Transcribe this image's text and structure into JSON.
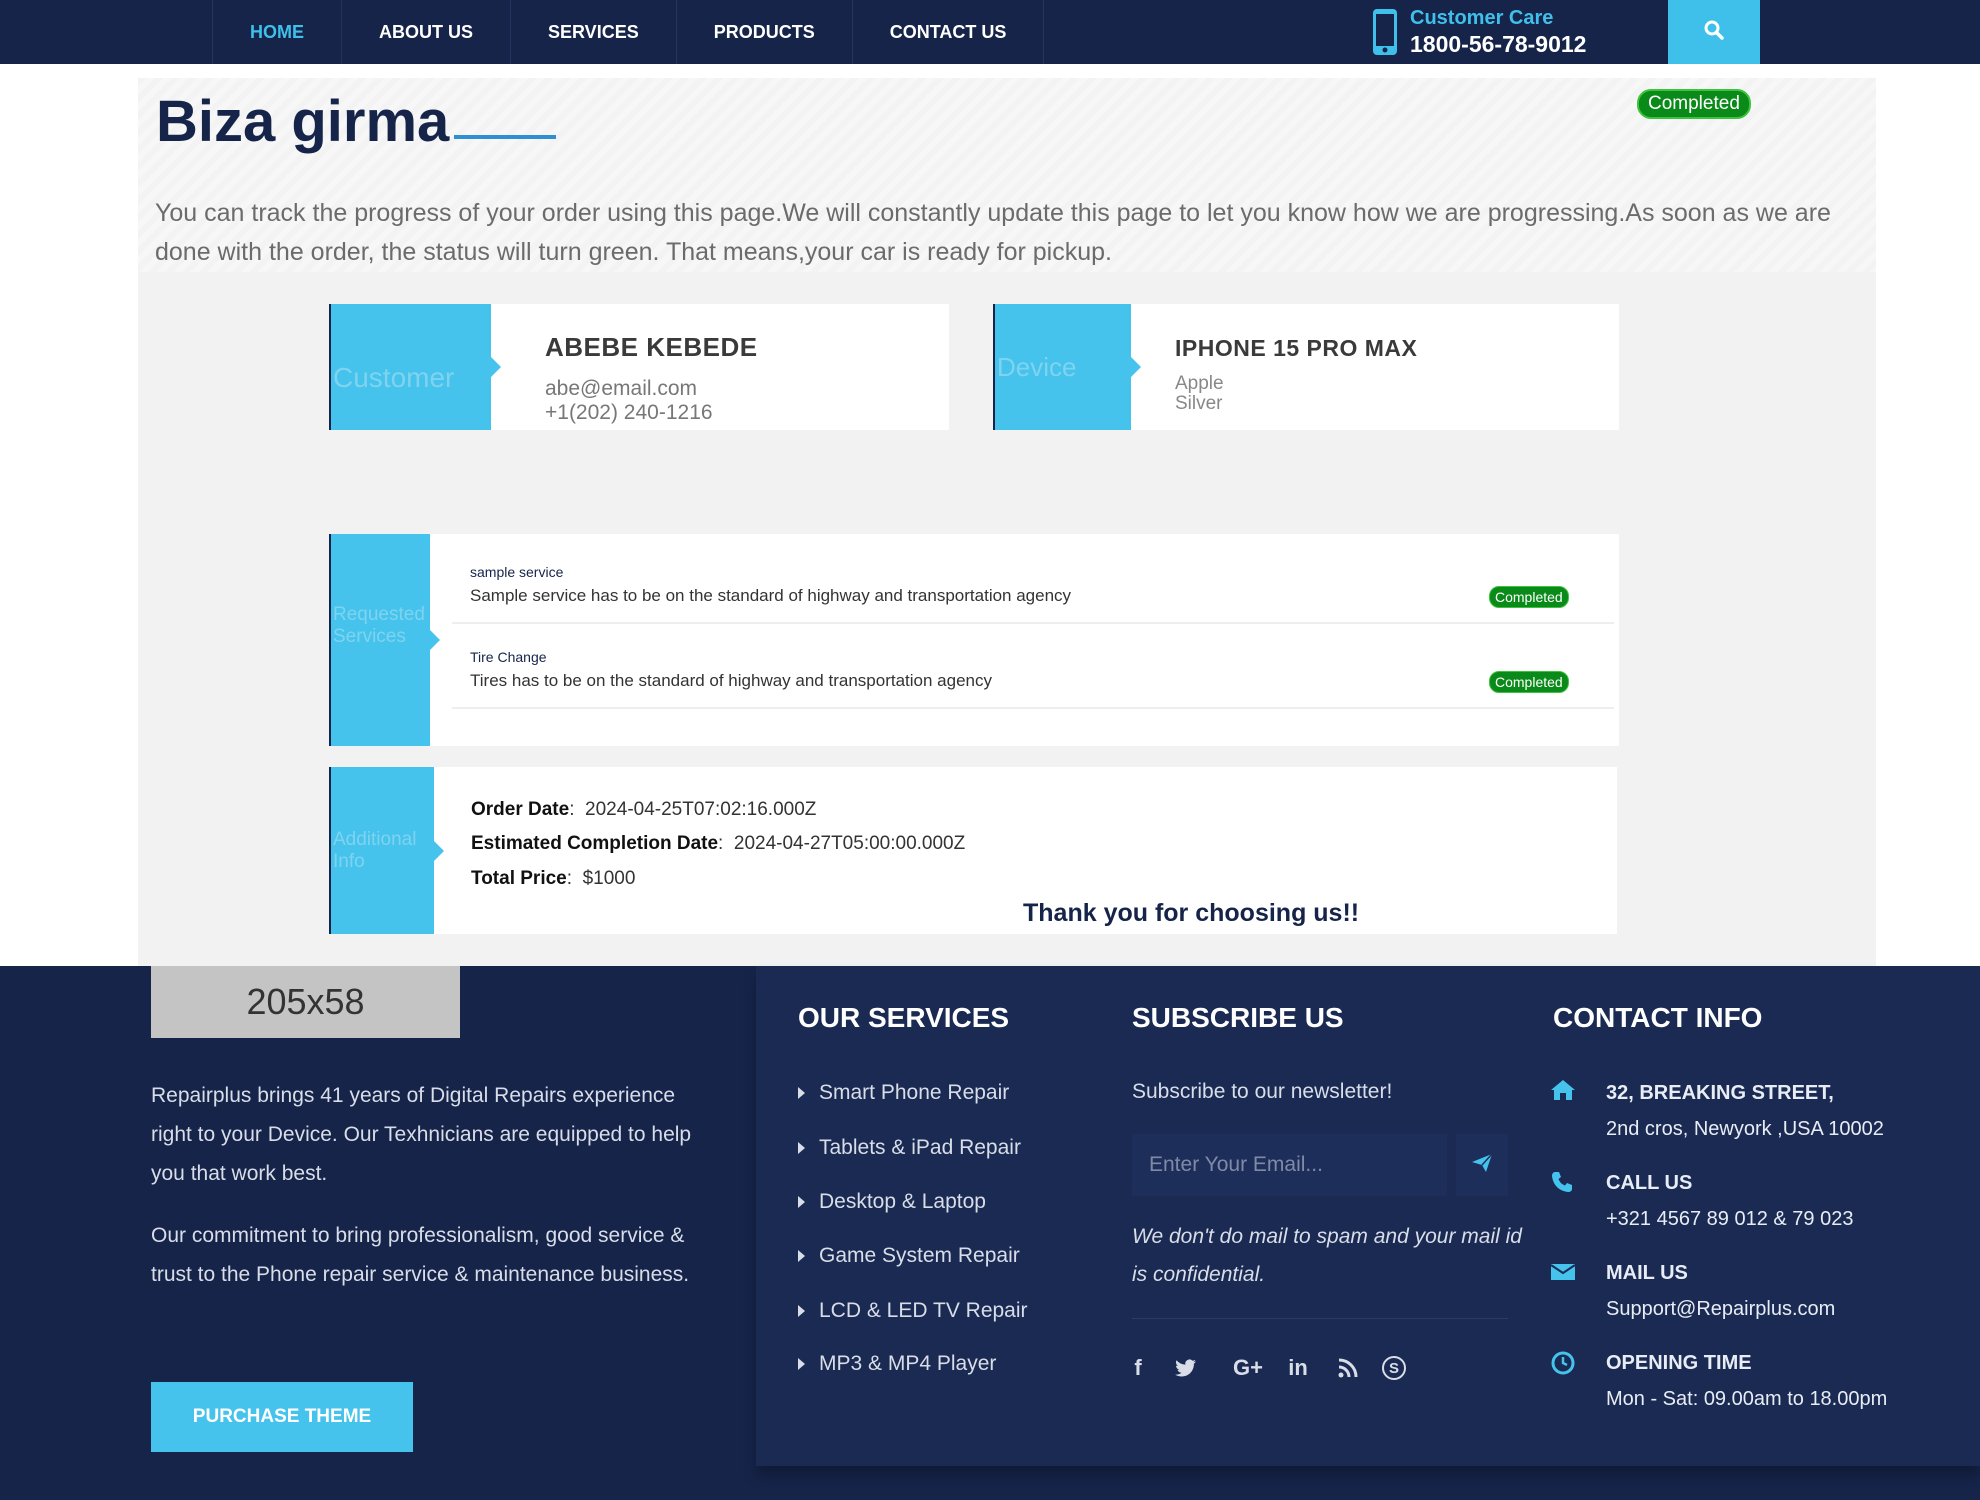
{
  "nav": {
    "items": [
      {
        "label": "HOME",
        "active": true
      },
      {
        "label": "ABOUT US"
      },
      {
        "label": "SERVICES"
      },
      {
        "label": "PRODUCTS"
      },
      {
        "label": "CONTACT US"
      }
    ],
    "care_label": "Customer Care",
    "care_number": "1800-56-78-9012"
  },
  "hero": {
    "title": "Biza girma",
    "status": "Completed",
    "description": "You can track the progress of your order using this page.We will constantly update this page to let you know how we are progressing.As soon as we are done with the order, the status will turn green. That means,your car is ready for pickup."
  },
  "customer": {
    "label": "Customer",
    "name": "ABEBE KEBEDE",
    "email": "abe@email.com",
    "phone": "+1(202) 240-1216"
  },
  "device": {
    "label": "Device",
    "name": "IPHONE 15 PRO MAX",
    "brand": "Apple",
    "color": "Silver"
  },
  "services": {
    "label": "Requested Services",
    "items": [
      {
        "name": "sample service",
        "description": "Sample service has to be on the standard of highway and transportation agency",
        "status": "Completed"
      },
      {
        "name": "Tire Change",
        "description": "Tires has to be on the standard of highway and transportation agency",
        "status": "Completed"
      }
    ]
  },
  "additional": {
    "label": "Additional Info",
    "order_date_label": "Order Date",
    "order_date": "2024-04-25T07:02:16.000Z",
    "est_label": "Estimated Completion Date",
    "est_date": "2024-04-27T05:00:00.000Z",
    "price_label": "Total Price",
    "price": "$1000",
    "thanks": "Thank you for choosing us!!"
  },
  "footer": {
    "logo_placeholder": "205x58",
    "about_p1": "Repairplus brings 41 years of Digital Repairs experience right to your Device. Our Texhnicians are equipped to help you that work best.",
    "about_p2": "Our commitment to bring professionalism, good service & trust to the Phone repair service & maintenance business.",
    "purchase_label": "PURCHASE THEME",
    "services_heading": "OUR SERVICES",
    "services": [
      "Smart Phone Repair",
      "Tablets & iPad Repair",
      "Desktop & Laptop",
      "Game System Repair",
      "LCD & LED TV Repair",
      "MP3 & MP4 Player"
    ],
    "subscribe_heading": "SUBSCRIBE US",
    "subscribe_text": "Subscribe to our newsletter!",
    "email_placeholder": "Enter Your Email...",
    "subscribe_note": "We don't do mail to spam and your mail id is confidential.",
    "social": [
      {
        "icon": "facebook-icon",
        "glyph": "f"
      },
      {
        "icon": "twitter-icon",
        "glyph": ""
      },
      {
        "icon": "google-plus-icon",
        "glyph": "G+"
      },
      {
        "icon": "linkedin-icon",
        "glyph": "in"
      },
      {
        "icon": "rss-icon",
        "glyph": ""
      },
      {
        "icon": "skype-icon",
        "glyph": "S"
      }
    ],
    "contact_heading": "CONTACT INFO",
    "address_line1": "32, BREAKING STREET,",
    "address_line2": "2nd cros, Newyork ,USA 10002",
    "call_label": "CALL US",
    "call_value": "+321 4567 89 012 & 79 023",
    "mail_label": "MAIL US",
    "mail_value": "Support@Repairplus.com",
    "open_label": "OPENING TIME",
    "open_value": "Mon - Sat: 09.00am to 18.00pm"
  },
  "colors": {
    "navy": "#16244a",
    "accent": "#3ec0ea",
    "success": "#0a8a18"
  }
}
